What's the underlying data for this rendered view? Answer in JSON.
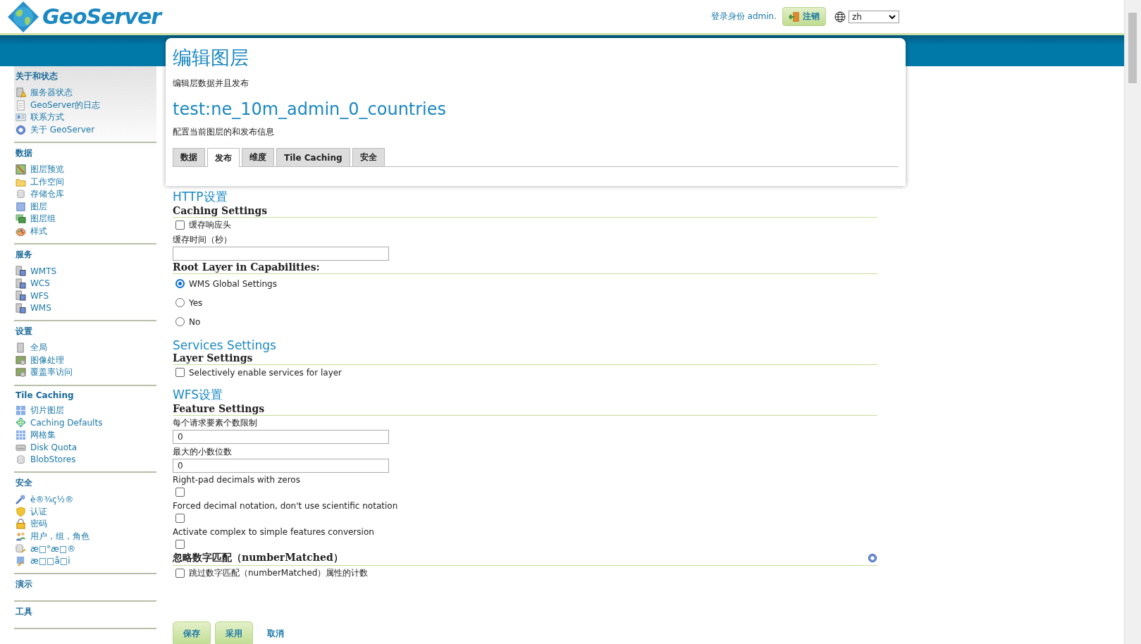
{
  "header": {
    "logo": "GeoServer",
    "login_text": "登录身份 admin.",
    "logout_button": "注销",
    "language": "zh"
  },
  "sidebar": {
    "sections": [
      {
        "title": "关于和状态",
        "items": [
          {
            "label": "服务器状态"
          },
          {
            "label": "GeoServer的日志"
          },
          {
            "label": "联系方式"
          },
          {
            "label": "关于 GeoServer"
          }
        ]
      },
      {
        "title": "数据",
        "items": [
          {
            "label": "图层预览"
          },
          {
            "label": "工作空间"
          },
          {
            "label": "存储仓库"
          },
          {
            "label": "图层"
          },
          {
            "label": "图层组"
          },
          {
            "label": "样式"
          }
        ]
      },
      {
        "title": "服务",
        "items": [
          {
            "label": "WMTS"
          },
          {
            "label": "WCS"
          },
          {
            "label": "WFS"
          },
          {
            "label": "WMS"
          }
        ]
      },
      {
        "title": "设置",
        "items": [
          {
            "label": "全局"
          },
          {
            "label": "图像处理"
          },
          {
            "label": "覆盖率访问"
          }
        ]
      },
      {
        "title": "Tile Caching",
        "items": [
          {
            "label": "切片图层"
          },
          {
            "label": "Caching Defaults"
          },
          {
            "label": "网格集"
          },
          {
            "label": "Disk Quota"
          },
          {
            "label": "BlobStores"
          }
        ]
      },
      {
        "title": "安全",
        "items": [
          {
            "label": "è®¾ç½®"
          },
          {
            "label": "认证"
          },
          {
            "label": "密码"
          },
          {
            "label": "用户，组，角色"
          },
          {
            "label": "æ□°æ□®"
          },
          {
            "label": "æ□□å□i"
          }
        ]
      },
      {
        "title": "演示"
      },
      {
        "title": "工具"
      }
    ]
  },
  "page": {
    "title": "编辑图层",
    "subtitle": "编辑层数据并且发布",
    "layer_name": "test:ne_10m_admin_0_countries",
    "description": "配置当前图层的和发布信息",
    "tabs": [
      {
        "label": "数据",
        "selected": false
      },
      {
        "label": "发布",
        "selected": true
      },
      {
        "label": "维度",
        "selected": false
      },
      {
        "label": "Tile Caching",
        "selected": false
      },
      {
        "label": "安全",
        "selected": false
      }
    ]
  },
  "form": [
    {
      "kind": "heading",
      "text": "HTTP设置"
    },
    {
      "kind": "subheading",
      "text": "Caching Settings"
    },
    {
      "kind": "checkbox",
      "label": "缓存响应头",
      "checked": false
    },
    {
      "kind": "label",
      "text": "缓存时间（秒）"
    },
    {
      "kind": "field"
    },
    {
      "kind": "subheading",
      "text": "Root Layer in Capabilities:"
    },
    {
      "kind": "radio",
      "label": "WMS Global Settings",
      "selected": true
    },
    {
      "kind": "radio",
      "label": "Yes",
      "selected": false
    },
    {
      "kind": "radio",
      "label": "No",
      "selected": false
    },
    {
      "kind": "heading",
      "text": "Services Settings"
    },
    {
      "kind": "subheading",
      "text": "Layer Settings"
    },
    {
      "kind": "checkbox",
      "label": "Selectively enable services for layer",
      "checked": false
    },
    {
      "kind": "heading",
      "text": "WFS设置"
    },
    {
      "kind": "subheading",
      "text": "Feature Settings"
    },
    {
      "kind": "label",
      "text": "每个请求要素个数限制"
    },
    {
      "kind": "field",
      "value": "0"
    },
    {
      "kind": "label",
      "text": "最大的小数位数"
    },
    {
      "kind": "field",
      "value": "0"
    },
    {
      "kind": "label",
      "text": "Right-pad decimals with zeros"
    },
    {
      "kind": "checkbox",
      "checked": false
    },
    {
      "kind": "label",
      "text": "Forced decimal notation, don't use scientific notation"
    },
    {
      "kind": "checkbox",
      "checked": false
    },
    {
      "kind": "label",
      "text": "Activate complex to simple features conversion"
    },
    {
      "kind": "checkbox",
      "checked": false
    },
    {
      "kind": "subheading",
      "text": "忽略数字匹配（numberMatched）",
      "help": true
    },
    {
      "kind": "checkbox",
      "label": "跳过数字匹配（numberMatched）属性的计数",
      "checked": false
    }
  ],
  "buttons": [
    {
      "label": "保存",
      "kind": "primary"
    },
    {
      "label": "采用",
      "kind": "primary"
    },
    {
      "label": "取消",
      "kind": "link"
    }
  ]
}
